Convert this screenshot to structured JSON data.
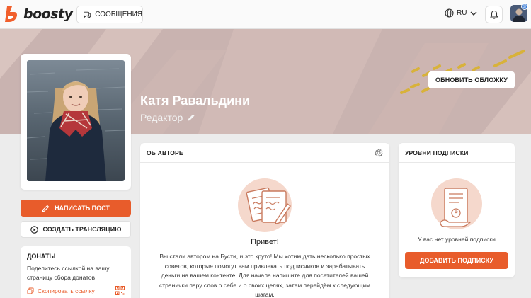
{
  "header": {
    "logo_text": "boosty",
    "messages_label": "СООБЩЕНИЯ",
    "language": "RU",
    "accent_color": "#e85c2b"
  },
  "cover": {
    "update_cover_label": "ОБНОВИТЬ ОБЛОЖКУ"
  },
  "profile": {
    "name": "Катя Равальдини",
    "role": "Редактор"
  },
  "actions": {
    "write_post_label": "НАПИСАТЬ ПОСТ",
    "create_stream_label": "СОЗДАТЬ ТРАНСЛЯЦИЮ"
  },
  "donations": {
    "title": "ДОНАТЫ",
    "text": "Поделитесь ссылкой на вашу страницу сбора донатов",
    "copy_link_label": "Скопировать ссылку"
  },
  "about": {
    "title": "ОБ АВТОРЕ",
    "greeting": "Привет!",
    "text": "Вы стали автором на Бусти, и это круто! Мы хотим дать несколько простых советов, которые помогут вам привлекать подписчиков и зарабатывать деньги на вашем контенте. Для начала напишите для посетителей вашей странички пару слов о себе и о своих целях, затем перейдём к следующим шагам."
  },
  "levels": {
    "title": "УРОВНИ ПОДПИСКИ",
    "empty_text": "У вас нет уровней подписки",
    "add_label": "ДОБАВИТЬ ПОДПИСКУ"
  }
}
